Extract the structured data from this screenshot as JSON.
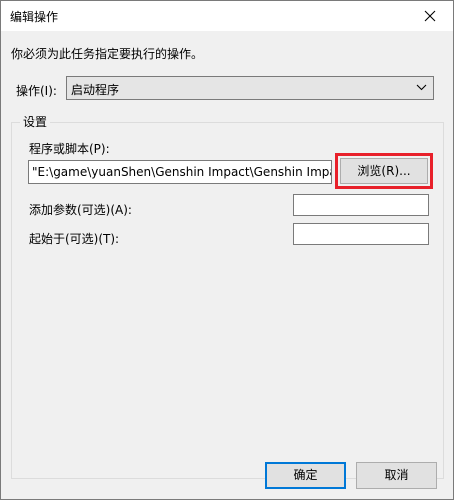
{
  "window": {
    "title": "编辑操作"
  },
  "instruction": "你必须为此任务指定要执行的操作。",
  "action": {
    "label": "操作(I):",
    "selected": "启动程序"
  },
  "settings": {
    "legend": "设置",
    "program_label": "程序或脚本(P):",
    "program_value": "\"E:\\game\\yuanShen\\Genshin Impact\\Genshin Impact",
    "browse_label": "浏览(R)...",
    "args_label": "添加参数(可选)(A):",
    "args_value": "",
    "start_label": "起始于(可选)(T):",
    "start_value": ""
  },
  "buttons": {
    "ok": "确定",
    "cancel": "取消"
  },
  "colors": {
    "highlight": "#e8202a",
    "focus": "#0078d7"
  },
  "icons": {
    "close": "close-icon",
    "dropdown": "chevron-down-icon"
  }
}
